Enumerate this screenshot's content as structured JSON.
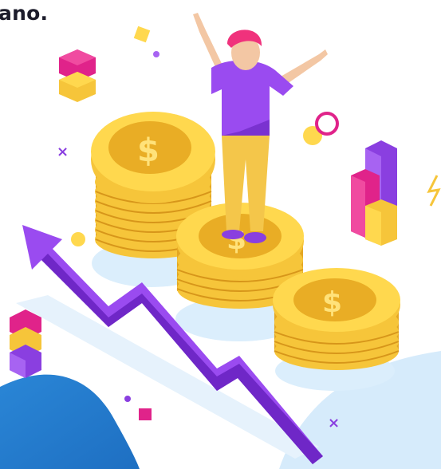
{
  "caption": {
    "text": "ano."
  },
  "palette": {
    "gold": "#f6c53a",
    "gold_dark": "#e4a622",
    "gold_light": "#ffe27a",
    "purple": "#8a3fe0",
    "purple_light": "#a763f2",
    "magenta": "#e0238a",
    "blue": "#2f8fd8",
    "light_blue": "#d8ecfb",
    "skin": "#f3c7a4",
    "hair": "#f0327c",
    "pants": "#f4c64a"
  },
  "icons": [
    "rising-arrow-icon",
    "coin-stack-icon",
    "dollar-sign-icon",
    "bar-chart-icon",
    "cube-stack-icon",
    "cross-icon",
    "ring-icon",
    "lightning-icon"
  ]
}
